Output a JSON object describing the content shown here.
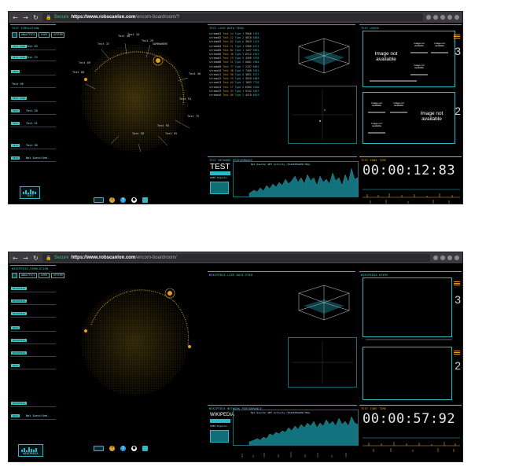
{
  "shots": [
    {
      "browser": {
        "secure_label": "Secure",
        "url_bold": "https://www.robscanlon.com",
        "url_rest": "/encom-boardroom/?"
      },
      "left_panel": {
        "header": "TEST SIMULATION",
        "tabs": [
          "ANALYTICS",
          "USER",
          "SYSTEM"
        ],
        "user_rows": [
          {
            "pill": "TEST USER",
            "label": "Test 63"
          },
          {
            "pill": "TEST USER",
            "label": "Test 72"
          },
          {
            "pill": "TEST",
            "label": ""
          },
          {
            "pill": "",
            "label": "Test 96"
          },
          {
            "pill": "TEST USER",
            "label": ""
          },
          {
            "pill": "TEST",
            "label": "Test 28"
          },
          {
            "pill": "TEST",
            "label": "Test 31"
          },
          {
            "pill": "TEST",
            "label": "Test 36"
          },
          {
            "pill": "TEST",
            "label": "Not Specified"
          }
        ],
        "logo_text": "TEST"
      },
      "globe_labels": [
        "Test 37",
        "Test 48",
        "Test 34",
        "Test 69",
        "Test 68",
        "Test 29",
        "SOMEWHERE",
        "Test 40",
        "Test 75",
        "Test 93",
        "Test 59",
        "Test 91",
        "Test 55"
      ],
      "mid_panel": {
        "header": "TEST LIVE DATA FEED",
        "streams": [
          {
            "name": "stream01",
            "test": "Test 14",
            "type": "Type 3",
            "v1": "9566",
            "v2": "1522"
          },
          {
            "name": "stream02",
            "test": "Test 12",
            "type": "Type 2",
            "v1": "5616",
            "v2": "6858"
          },
          {
            "name": "stream03",
            "test": "Test 62",
            "type": "Type 6",
            "v1": "3029",
            "v2": "1215"
          },
          {
            "name": "stream04",
            "test": "Test 11",
            "type": "Type 4",
            "v1": "5566",
            "v2": "4474"
          },
          {
            "name": "stream05",
            "test": "Test 82",
            "type": "Type 1",
            "v1": "1227",
            "v2": "6561"
          },
          {
            "name": "stream06",
            "test": "Test 46",
            "type": "Type 3",
            "v1": "8712",
            "v2": "1015"
          },
          {
            "name": "stream07",
            "test": "Test 23",
            "type": "Type 9",
            "v1": "4309",
            "v2": "3370"
          },
          {
            "name": "stream08",
            "test": "Test 51",
            "type": "Type 2",
            "v1": "6601",
            "v2": "2984"
          },
          {
            "name": "stream09",
            "test": "Test 77",
            "type": "Type 7",
            "v1": "2197",
            "v2": "8052"
          },
          {
            "name": "stream10",
            "test": "Test 38",
            "type": "Type 5",
            "v1": "7460",
            "v2": "5541"
          },
          {
            "name": "stream11",
            "test": "Test 90",
            "type": "Type 8",
            "v1": "3851",
            "v2": "9217"
          },
          {
            "name": "stream12",
            "test": "Test 19",
            "type": "Type 4",
            "v1": "5018",
            "v2": "4903"
          },
          {
            "name": "stream13",
            "test": "Test 64",
            "type": "Type 1",
            "v1": "1893",
            "v2": "7726"
          },
          {
            "name": "stream14",
            "test": "Test 27",
            "type": "Type 6",
            "v1": "6305",
            "v2": "3180"
          },
          {
            "name": "stream15",
            "test": "Test 53",
            "type": "Type 3",
            "v1": "9142",
            "v2": "2647"
          },
          {
            "name": "stream16",
            "test": "Test 86",
            "type": "Type 2",
            "v1": "4470",
            "v2": "6019"
          }
        ]
      },
      "right_panel": {
        "header": "TEST USERS",
        "box1_main": "Image not available",
        "box1_small": [
          "Image not available",
          "Image not available",
          "Image not available"
        ],
        "box1_digit": "3",
        "box2_main": "Image not available",
        "box2_small": [
          "Image not available",
          "Image not available",
          "Image not available"
        ],
        "box2_digit": "2"
      },
      "bottom_mid": {
        "header": "TEST NETWORK PERFORMANCE",
        "big_label": "TEST",
        "caption": "INFO Exports",
        "graph_title": "Net Quarter NET Activity (PLACEHOLDER MSG)"
      },
      "bottom_right": {
        "header": "TEST ZONE TIME",
        "clock": "00:00:12:83"
      }
    },
    {
      "browser": {
        "secure_label": "Secure",
        "url_bold": "https://www.robscanlon.com",
        "url_rest": "/encom-boardroom/"
      },
      "left_panel": {
        "header": "WIKIPEDIA SIMULATION",
        "tabs": [
          "ANALYTICS",
          "USER",
          "SYSTEM"
        ],
        "user_rows": [
          {
            "pill": "WIKIPEDIA",
            "label": ""
          },
          {
            "pill": "WIKIPEDIA",
            "label": ""
          },
          {
            "pill": "WIKIPEDIA",
            "label": ""
          },
          {
            "pill": "WIKI",
            "label": ""
          },
          {
            "pill": "WIKIPEDIA",
            "label": ""
          },
          {
            "pill": "WIKIPEDIA",
            "label": ""
          },
          {
            "pill": "WIKI",
            "label": ""
          },
          {
            "pill": "WIKIPEDIA",
            "label": ""
          },
          {
            "pill": "WIKI",
            "label": "Not Specified"
          }
        ],
        "logo_text": "WIKIPEDIA"
      },
      "globe_labels": [
        "SOMEWHERE"
      ],
      "mid_panel": {
        "header": "WIKIPEDIA LIVE DATA FEED",
        "streams": []
      },
      "right_panel": {
        "header": "WIKIPEDIA USERS",
        "box1_main": "",
        "box1_small": [],
        "box1_digit": "3",
        "box2_main": "",
        "box2_small": [],
        "box2_digit": "2"
      },
      "bottom_mid": {
        "header": "WIKIPEDIA NETWORK PERFORMANCE",
        "big_label": "WIKIPEDIA",
        "caption": "INFO Exports",
        "graph_title": "Net Quarter NET Activity (PLACEHOLDER MSG)"
      },
      "bottom_right": {
        "header": "TEST ZONE TIME",
        "clock": "00:00:57:92"
      }
    }
  ],
  "colors": {
    "accent": "#2fb8c8",
    "orange": "#e8a020",
    "globe": "#c9a227",
    "bg": "#000000"
  }
}
